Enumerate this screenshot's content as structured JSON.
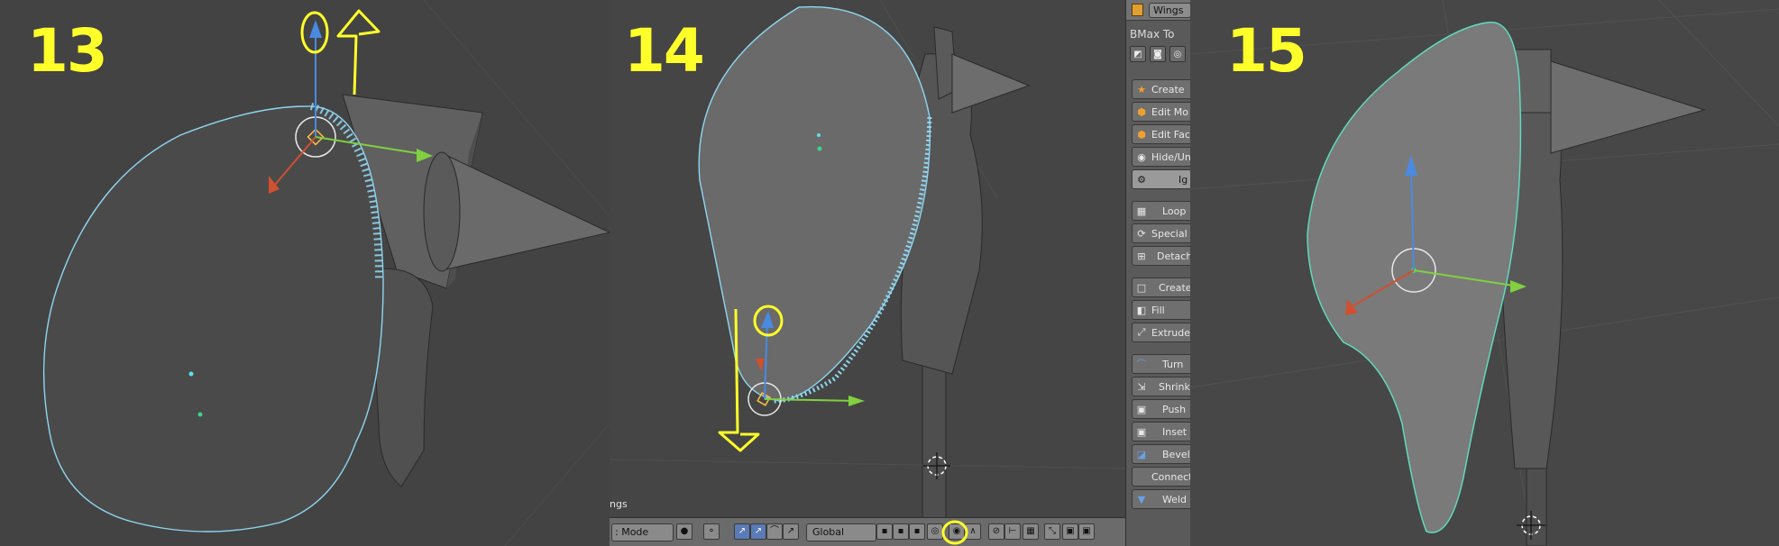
{
  "steps": {
    "step13": "13",
    "step14": "14",
    "step15": "15"
  },
  "toolshelf": {
    "object_name": "Wings",
    "panel_title": "BMax To",
    "buttons": [
      {
        "label": "Create",
        "icon": "star-icon"
      },
      {
        "label": "Edit Mo",
        "icon": "mesh-edit-icon"
      },
      {
        "label": "Edit Fac",
        "icon": "face-icon"
      },
      {
        "label": "Hide/Un",
        "icon": "eye-icon"
      },
      {
        "label": "Ig",
        "icon": "gear-icon",
        "active": true
      },
      {
        "label": "Loop",
        "icon": "loop-icon"
      },
      {
        "label": "Special",
        "icon": "loop-special-icon"
      },
      {
        "label": "Detach",
        "icon": "detach-icon"
      },
      {
        "label": "Create",
        "icon": "square-icon"
      },
      {
        "label": "Fill",
        "icon": "fill-icon"
      },
      {
        "label": "Extrude",
        "icon": "extrude-icon"
      },
      {
        "label": "Turn",
        "icon": "turn-icon"
      },
      {
        "label": "Shrink",
        "icon": "shrink-icon"
      },
      {
        "label": "Push",
        "icon": "push-icon"
      },
      {
        "label": "Inset",
        "icon": "inset-icon"
      },
      {
        "label": "Bevel",
        "icon": "bevel-icon"
      },
      {
        "label": "Connect",
        "icon": "connect-icon"
      },
      {
        "label": "Weld",
        "icon": "weld-icon"
      }
    ]
  },
  "view_header": {
    "view_name": "ngs",
    "mode": ": Mode",
    "orientation": "Global"
  },
  "colors": {
    "annotation": "#ffff2a",
    "selection_outline": "#8fd6f0",
    "axis_x": "#80d040",
    "axis_y": "#4a8ae0",
    "axis_z": "#d05030"
  }
}
